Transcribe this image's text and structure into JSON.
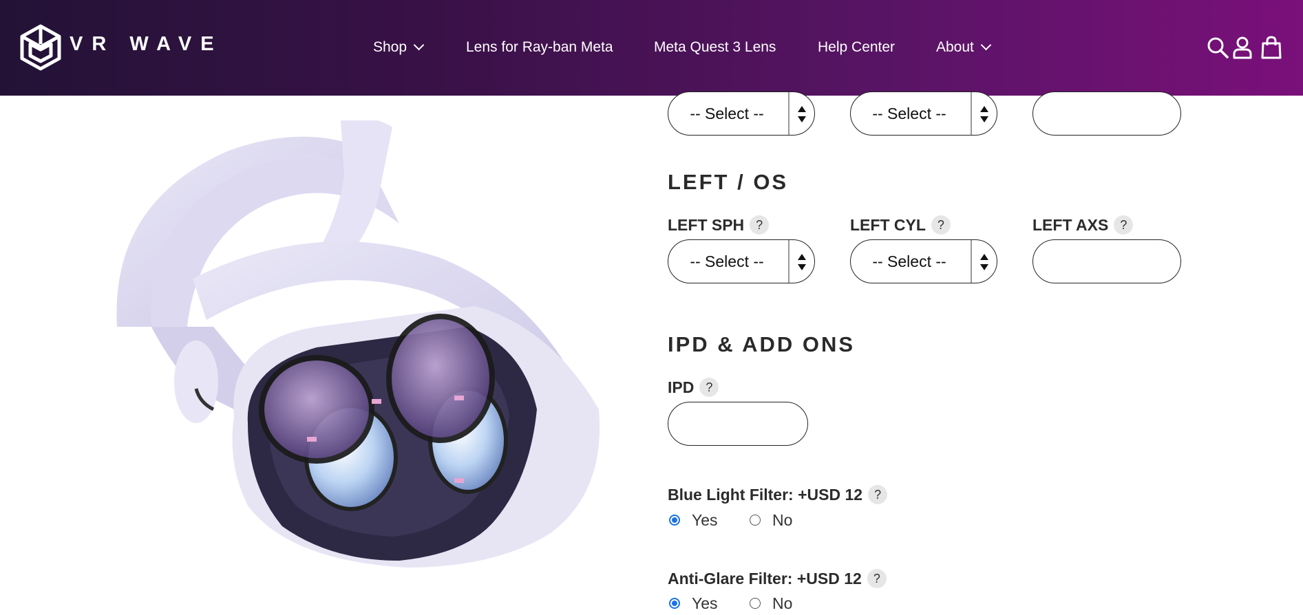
{
  "header": {
    "brand": "VR WAVE",
    "nav": [
      {
        "label": "Shop",
        "dropdown": true
      },
      {
        "label": "Lens for Ray-ban Meta",
        "dropdown": false
      },
      {
        "label": "Meta Quest 3 Lens",
        "dropdown": false
      },
      {
        "label": "Help Center",
        "dropdown": false
      },
      {
        "label": "About",
        "dropdown": true
      }
    ],
    "icons": [
      "search-icon",
      "account-icon",
      "cart-icon"
    ]
  },
  "right_row": {
    "sph_select": "-- Select --",
    "cyl_select": "-- Select --",
    "axs_value": ""
  },
  "left_os": {
    "title": "LEFT / OS",
    "sph_label": "LEFT SPH",
    "cyl_label": "LEFT CYL",
    "axs_label": "LEFT AXS",
    "sph_select": "-- Select --",
    "cyl_select": "-- Select --",
    "axs_value": ""
  },
  "ipd": {
    "title": "IPD & ADD ONS",
    "ipd_label": "IPD",
    "ipd_value": ""
  },
  "blue_light": {
    "label": "Blue Light Filter: +USD 12",
    "yes": "Yes",
    "no": "No",
    "selected": "Yes"
  },
  "anti_glare": {
    "label": "Anti-Glare Filter: +USD 12",
    "yes": "Yes",
    "no": "No",
    "selected": "Yes"
  },
  "help_glyph": "?",
  "colors": {
    "header_start": "#231236",
    "header_end": "#7a107a",
    "radio_accent": "#1a73e8"
  }
}
